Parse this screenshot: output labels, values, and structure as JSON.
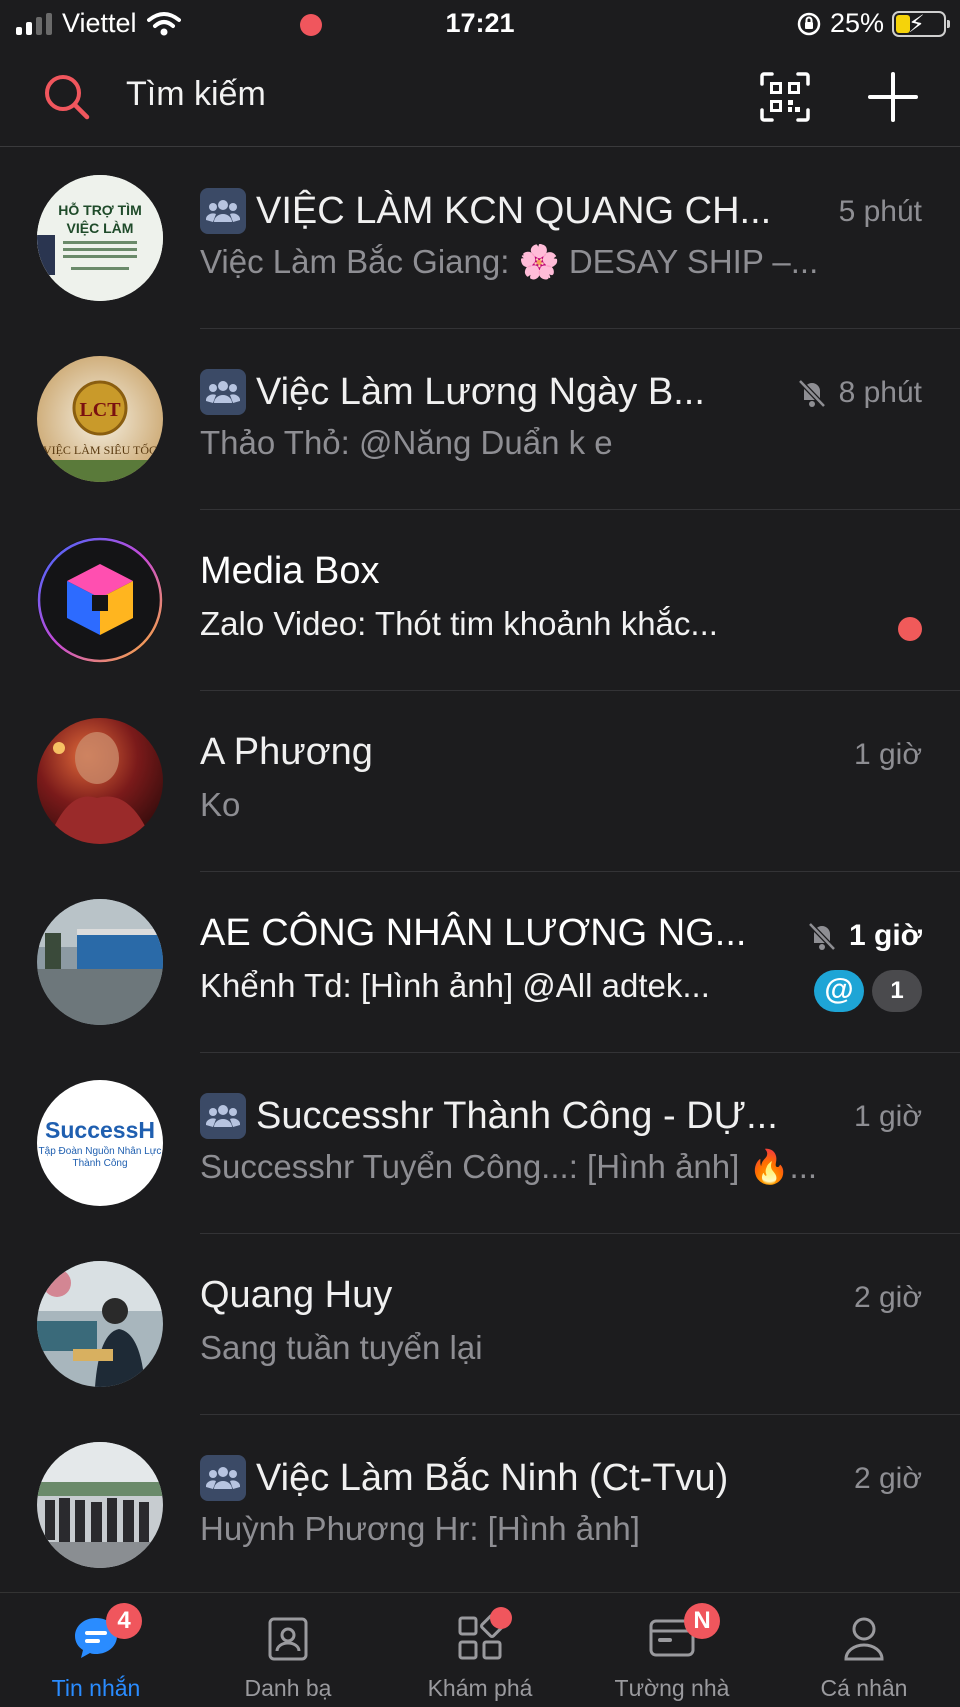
{
  "status_bar": {
    "carrier": "Viettel",
    "time": "17:21",
    "battery": "25%"
  },
  "search": {
    "placeholder": "Tìm kiếm"
  },
  "conversations": [
    {
      "title": "VIỆC LÀM KCN QUANG CH...",
      "preview": "Việc Làm Bắc Giang: 🌸 DESAY SHIP –...",
      "time": "5 phút",
      "group": true
    },
    {
      "title": "Việc Làm Lương Ngày B...",
      "preview": "Thảo Thỏ: @Năng Duẩn k e",
      "time": "8 phút",
      "group": true,
      "muted": true
    },
    {
      "title": "Media Box",
      "preview": "Zalo Video: Thót tim khoảnh khắc...",
      "time": "",
      "unread_dot": true
    },
    {
      "title": "A Phương",
      "preview": "Ko",
      "time": "1 giờ"
    },
    {
      "title": "AE CÔNG NHÂN LƯƠNG NG...",
      "preview": "Khểnh Td: [Hình ảnh] @All adtek...",
      "time": "1 giờ",
      "muted": true,
      "mention": "@",
      "unread_count": "1"
    },
    {
      "title": "Successhr Thành Công - DỰ...",
      "preview": "Successhr Tuyển Công...: [Hình ảnh] 🔥...",
      "time": "1 giờ",
      "group": true
    },
    {
      "title": "Quang Huy",
      "preview": "Sang tuần tuyển lại",
      "time": "2 giờ"
    },
    {
      "title": "Việc Làm Bắc Ninh (Ct-Tvu)",
      "preview": "Huỳnh Phương Hr: [Hình ảnh]",
      "time": "2 giờ",
      "group": true
    }
  ],
  "avatar_text": {
    "a0_line1": "HỖ TRỢ TÌM",
    "a0_line2": "VIỆC LÀM",
    "a1_logo": "LCT",
    "a1_sub": "VIỆC LÀM SIÊU TỐC",
    "a5_brand": "SuccessH",
    "a5_line1": "Tập Đoàn Nguồn Nhân Lực",
    "a5_line2": "Thành Công"
  },
  "nav": [
    {
      "label": "Tin nhắn",
      "badge": "4",
      "active": true
    },
    {
      "label": "Danh bạ"
    },
    {
      "label": "Khám phá"
    },
    {
      "label": "Tường nhà",
      "badge": "N"
    },
    {
      "label": "Cá nhân"
    }
  ],
  "colors": {
    "accent": "#2a8cff",
    "badge_red": "#f0565d",
    "background": "#1c1c1e",
    "mention_blue": "#1ea5d6"
  }
}
